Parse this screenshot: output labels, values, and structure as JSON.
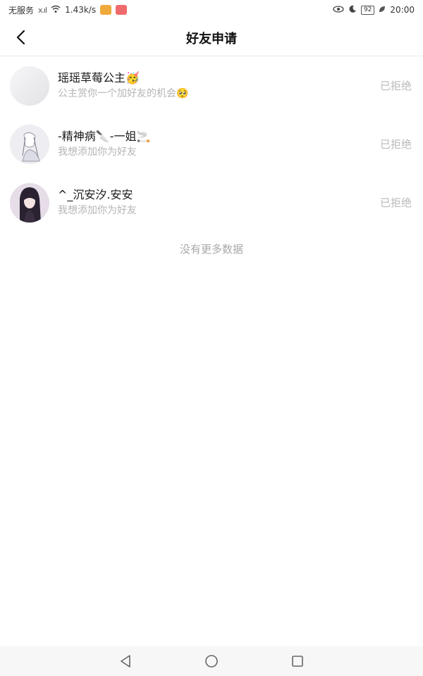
{
  "status_bar": {
    "carrier": "无服务",
    "signal": "x.ıl",
    "speed": "1.43k/s",
    "battery": "92",
    "time": "20:00"
  },
  "header": {
    "title": "好友申请"
  },
  "requests": [
    {
      "name": "瑶瑶草莓公主🥳",
      "message": "公主赏你一个加好友的机会🥺",
      "status": "已拒绝"
    },
    {
      "name": "-精神病🔪-一姐🚬",
      "message": "我想添加你为好友",
      "status": "已拒绝"
    },
    {
      "name": "^_沉安汐.安安",
      "message": "我想添加你为好友",
      "status": "已拒绝"
    }
  ],
  "footer_note": "没有更多数据"
}
